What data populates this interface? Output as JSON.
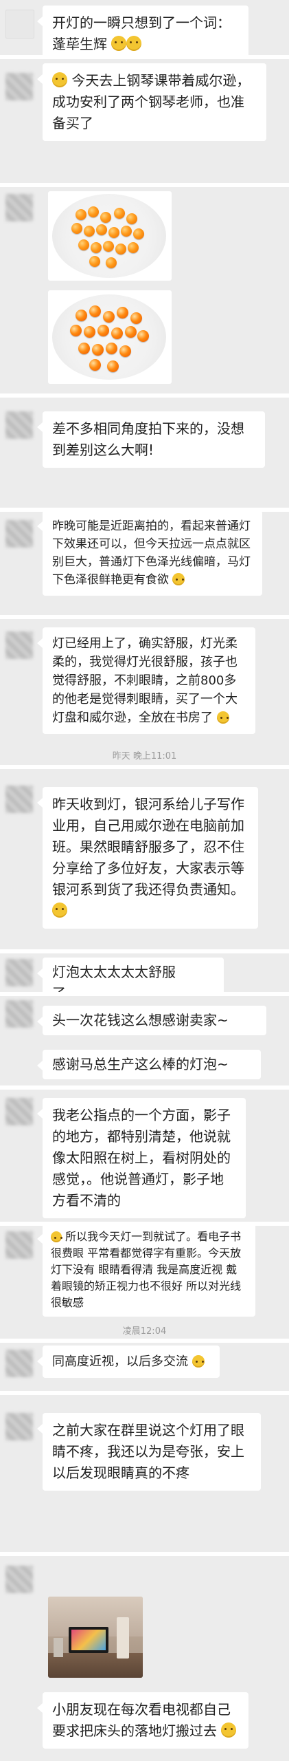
{
  "messages": [
    {
      "text": "开灯的一瞬只想到了一个词：蓬荜生辉"
    },
    {
      "text": "今天去上钢琴课带着威尔逊，成功安利了两个钢琴老师，也准备买了"
    },
    {
      "text": "差不多相同角度拍下来的，没想到差别这么大啊!"
    },
    {
      "text": "昨晚可能是近距离拍的，看起来普通灯下效果还可以，但今天拉远一点点就区别巨大，普通灯下色泽光线偏暗，马灯下色泽很鲜艳更有食欲"
    },
    {
      "text": "灯已经用上了，确实舒服，灯光柔柔的，我觉得灯光很舒服，孩子也觉得舒服，不刺眼睛，之前800多的他老是觉得刺眼睛，买了一个大灯盘和威尔逊，全放在书房了"
    },
    {
      "text": "昨天收到灯，银河系给儿子写作业用，自己用威尔逊在电脑前加班。果然眼睛舒服多了，忍不住分享给了多位好友，大家表示等银河系到货了我还得负责通知。"
    },
    {
      "text": "灯泡太太太太太舒服了……"
    },
    {
      "text": "头一次花钱这么想感谢卖家~"
    },
    {
      "text": "感谢马总生产这么棒的灯泡~"
    },
    {
      "text": "我老公指点的一个方面，影子的地方，都特别清楚，他说就像太阳照在树上，看树阴处的感觉，。他说普通灯，影子地方看不清的"
    },
    {
      "text": "所以我今天灯一到就试了。看电子书很费眼 平常看都觉得字有重影。今天放灯下没有 眼睛看得清 我是高度近视 戴着眼镜的矫正视力也不很好 所以对光线很敏感"
    },
    {
      "text": "同高度近视，以后多交流"
    },
    {
      "text": "之前大家在群里说这个灯用了眼睛不疼，我还以为是夸张，安上以后发现眼睛真的不疼"
    },
    {
      "text": "小朋友现在每次看电视都自己要求把床头的落地灯搬过去"
    }
  ],
  "timestamps": {
    "t1": "昨天 晚上11:01",
    "t2": "凌晨12:04"
  }
}
